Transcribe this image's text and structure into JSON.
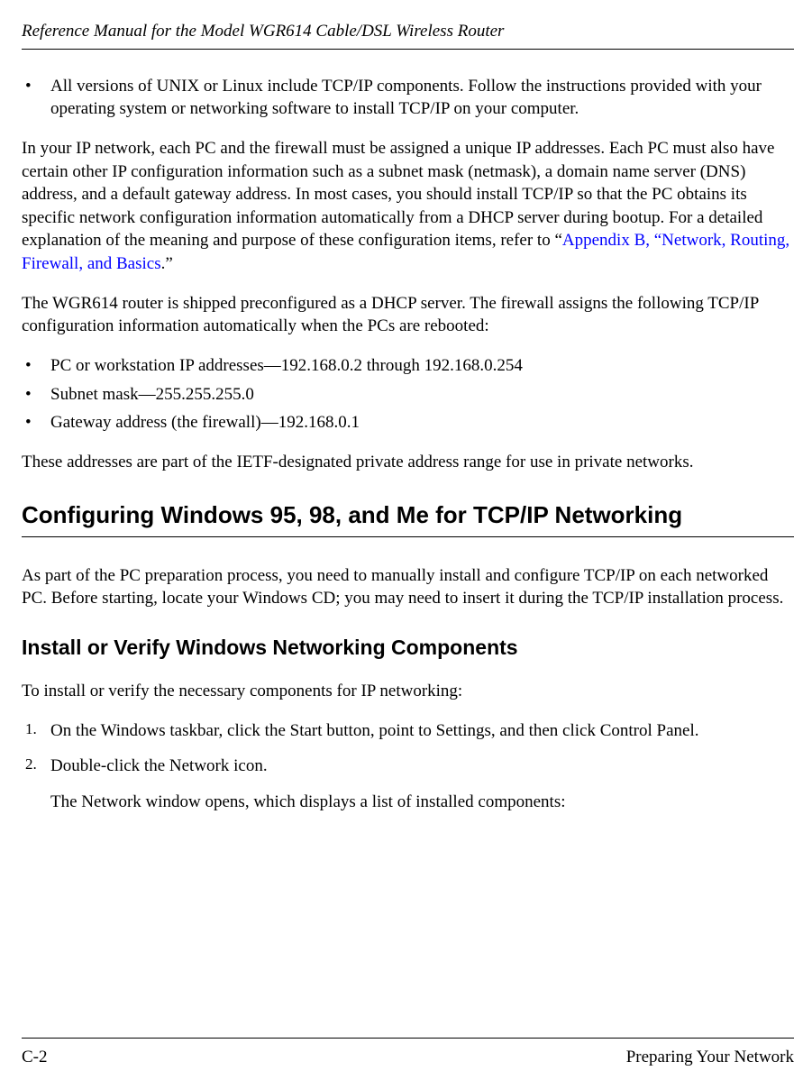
{
  "header": {
    "title": "Reference Manual for the Model WGR614 Cable/DSL Wireless Router"
  },
  "content": {
    "bullet1": "All versions of UNIX or Linux include TCP/IP components. Follow the instructions provided with your operating system or networking software to install TCP/IP on your computer.",
    "para1_a": "In your IP network, each PC and the firewall must be assigned a unique IP addresses. Each PC must also have certain other IP configuration information such as a subnet mask (netmask), a domain name server (DNS) address, and a default gateway address. In most cases, you should install TCP/IP so that the PC obtains its specific network configuration information automatically from a DHCP server during bootup. For a detailed explanation of the meaning and purpose of these configuration items, refer to “",
    "para1_link": "Appendix B, “Network, Routing, Firewall, and Basics",
    "para1_b": ".”",
    "para2": "The WGR614 router is shipped preconfigured as a DHCP server. The firewall assigns the following TCP/IP configuration information automatically when the PCs are rebooted:",
    "list": {
      "item1": "PC or workstation IP addresses—192.168.0.2 through 192.168.0.254",
      "item2": "Subnet mask—255.255.255.0",
      "item3": "Gateway address (the firewall)—192.168.0.1"
    },
    "para3": "These addresses are part of the IETF-designated private address range for use in private networks.",
    "heading1": "Configuring Windows 95, 98, and Me for TCP/IP Networking",
    "para4": "As part of the PC preparation process, you need to manually install and configure TCP/IP on each networked PC. Before starting, locate your Windows CD; you may need to insert it during the TCP/IP installation process.",
    "heading2": "Install or Verify Windows Networking Components",
    "para5": "To install or verify the necessary components for IP networking:",
    "steps": {
      "n1": "1.",
      "s1": "On the Windows taskbar, click the Start button, point to Settings, and then click Control Panel.",
      "n2": "2.",
      "s2": "Double-click the Network icon.",
      "s2b": "The Network window opens, which displays a list of installed components:"
    }
  },
  "footer": {
    "left": "C-2",
    "right": "Preparing Your Network"
  }
}
